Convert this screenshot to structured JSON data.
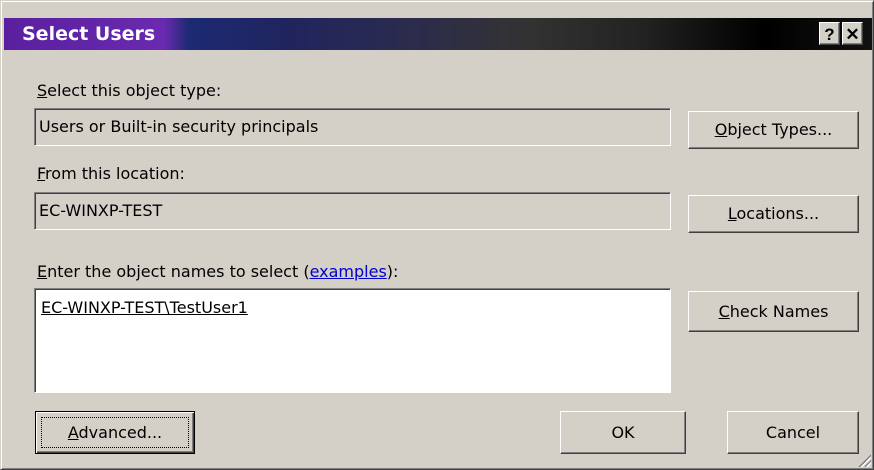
{
  "window": {
    "title": "Select Users",
    "help_button": "?",
    "close_button": "✕"
  },
  "object_type": {
    "label_key": "S",
    "label_rest": "elect this object type:",
    "value": "Users or Built-in security principals",
    "button_key": "O",
    "button_rest": "bject Types..."
  },
  "location": {
    "label_key": "F",
    "label_rest": "rom this location:",
    "value": "EC-WINXP-TEST",
    "button_key": "L",
    "button_rest": "ocations..."
  },
  "names": {
    "label_key": "E",
    "label_rest": "nter the object names to select (",
    "label_link": "examples",
    "label_end": "):",
    "value": "EC-WINXP-TEST\\TestUser1",
    "check_key": "C",
    "check_rest": "heck Names"
  },
  "footer": {
    "advanced_key": "A",
    "advanced_rest": "dvanced...",
    "ok": "OK",
    "cancel": "Cancel"
  },
  "icons": [
    "help-icon",
    "close-icon",
    "resize-grip-icon"
  ]
}
